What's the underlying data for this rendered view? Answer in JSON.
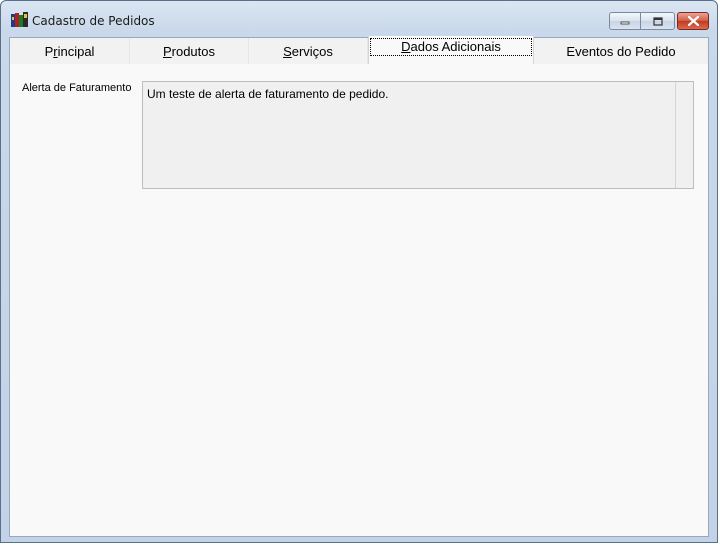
{
  "window": {
    "title": "Cadastro de Pedidos",
    "icon": "cadastro-app-icon"
  },
  "controls": {
    "minimize_icon": "minimize-icon",
    "maximize_icon": "maximize-icon",
    "close_icon": "close-icon"
  },
  "tabs": [
    {
      "pre": "P",
      "u": "r",
      "post": "incipal"
    },
    {
      "pre": "",
      "u": "P",
      "post": "rodutos"
    },
    {
      "pre": "",
      "u": "S",
      "post": "erviços"
    },
    {
      "pre": "",
      "u": "D",
      "post": "ados Adicionais"
    },
    {
      "pre": "Eventos do Pedido",
      "u": "",
      "post": ""
    }
  ],
  "active_tab": "Dados Adicionais",
  "form": {
    "alerta_label": "Alerta de Faturamento",
    "alerta_value": "Um teste de alerta de faturamento de pedido."
  },
  "colors": {
    "close_button": "#c23a20",
    "page_background": "#f9f9f9",
    "memo_background": "#f0f0f0"
  }
}
